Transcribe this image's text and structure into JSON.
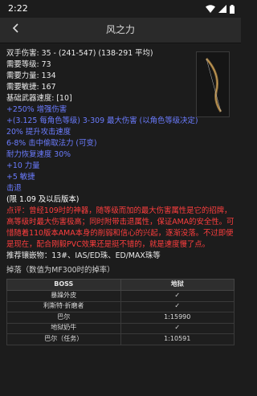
{
  "status": {
    "time": "2:22"
  },
  "header": {
    "title": "风之力"
  },
  "stats": {
    "damage": "双手伤害: 35 - (241-547) (138-291 平均)",
    "req_level": "需要等级: 73",
    "req_str": "需要力量: 134",
    "req_dex": "需要敏捷: 167",
    "speed": "基础武器速度: [10]"
  },
  "magic_props": [
    "+250% 增强伤害",
    "+(3.125 每角色等级) 3-309 最大伤害 (以角色等级决定)",
    "20% 提升攻击速度",
    "6-8% 击中偷取法力 (可变)",
    "耐力恢复速度 30%",
    "+10 力量",
    "+5 敏捷",
    "击退"
  ],
  "version_note": "(限 1.09 及以后版本)",
  "comment": "点评：曾经109时的神器，随等级而加的最大伤害属性是它的招牌，高等级时最大伤害极高；同时附带击退属性，保证AMA的安全性。可惜随着110版本AMA本身的削弱和信心的兴起，逐渐没落。不过即便是现在，配合刚毅PVC效果还是挺不错的，就是速度慢了点。",
  "sockets": "推荐镶嵌物：13#、IAS/ED珠、ED/MAX珠等",
  "drop": {
    "title": "掉落（数值为MF300时的掉率）",
    "headers": [
      "BOSS",
      "地狱"
    ],
    "rows": [
      {
        "boss": "暴躁外皮",
        "value": "✓"
      },
      {
        "boss": "利斯特·折磨者",
        "value": "✓"
      },
      {
        "boss": "巴尔",
        "value": "1:15990"
      },
      {
        "boss": "地狱奶牛",
        "value": "✓"
      },
      {
        "boss": "巴尔（任务）",
        "value": "1:10591"
      }
    ]
  }
}
